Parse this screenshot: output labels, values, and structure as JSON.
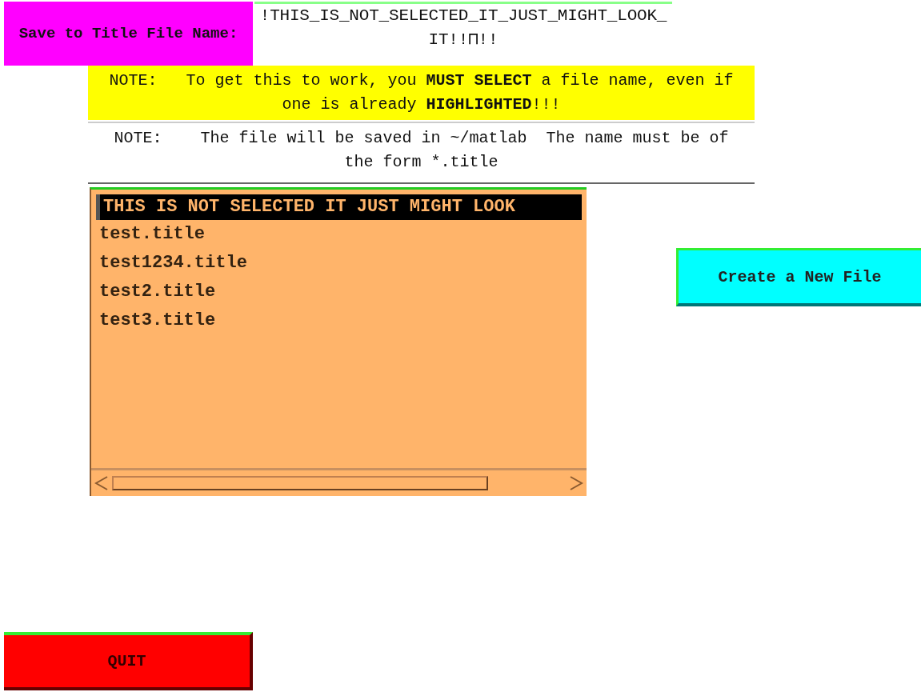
{
  "save_label": "Save to Title File Name:",
  "filename_field": {
    "value": "!THIS_IS_NOT_SELECTED_IT_JUST_MIGHT_LOOK_IT!!⊓!!"
  },
  "notes": [
    {
      "text": "NOTE:   To get this to work, you **MUST SELECT** a file name, even if one is already **HIGHLIGHTED**!!!",
      "color": "#ffff00"
    },
    {
      "text": "NOTE:    The file will be saved in ~/matlab  The name must be of the form *.title",
      "color": "#ffffff"
    }
  ],
  "file_list": {
    "items": [
      {
        "label": "THIS IS NOT SELECTED IT JUST MIGHT LOOK",
        "selected": true
      },
      {
        "label": "test.title",
        "selected": false
      },
      {
        "label": "test1234.title",
        "selected": false
      },
      {
        "label": "test2.title",
        "selected": false
      },
      {
        "label": "test3.title",
        "selected": false
      }
    ]
  },
  "buttons": [
    {
      "label": "Create a New File",
      "kind": "create"
    },
    {
      "label": "QUIT",
      "kind": "quit"
    }
  ]
}
